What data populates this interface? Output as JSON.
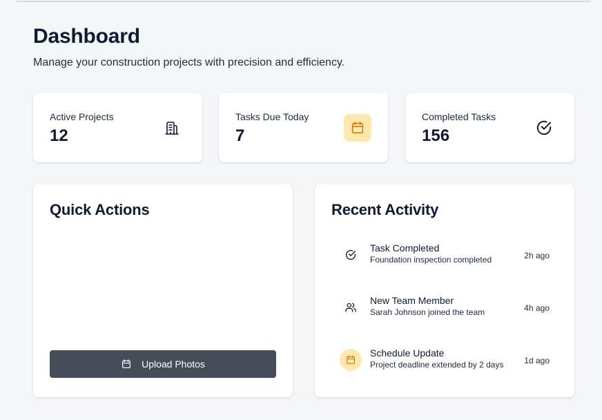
{
  "header": {
    "title": "Dashboard",
    "subtitle": "Manage your construction projects with precision and efficiency."
  },
  "stats": [
    {
      "label": "Active Projects",
      "value": "12",
      "icon": "building-icon"
    },
    {
      "label": "Tasks Due Today",
      "value": "7",
      "icon": "calendar-icon",
      "icon_bg": "#fde9b0"
    },
    {
      "label": "Completed Tasks",
      "value": "156",
      "icon": "check-circle-icon"
    }
  ],
  "quick_actions": {
    "title": "Quick Actions",
    "upload_label": "Upload Photos",
    "upload_icon": "calendar-icon",
    "button_color": "#464c58"
  },
  "recent_activity": {
    "title": "Recent Activity",
    "items": [
      {
        "title": "Task Completed",
        "description": "Foundation inspection completed",
        "time": "2h ago",
        "icon": "check-circle-icon"
      },
      {
        "title": "New Team Member",
        "description": "Sarah Johnson joined the team",
        "time": "4h ago",
        "icon": "users-icon"
      },
      {
        "title": "Schedule Update",
        "description": "Project deadline extended by 2 days",
        "time": "1d ago",
        "icon": "calendar-icon",
        "icon_bg": "#fde9b0"
      }
    ]
  },
  "colors": {
    "background": "#f5f6f8",
    "text_primary": "#0f1b33",
    "accent_amber": "#fde9b0",
    "accent_amber_stroke": "#d97706"
  }
}
